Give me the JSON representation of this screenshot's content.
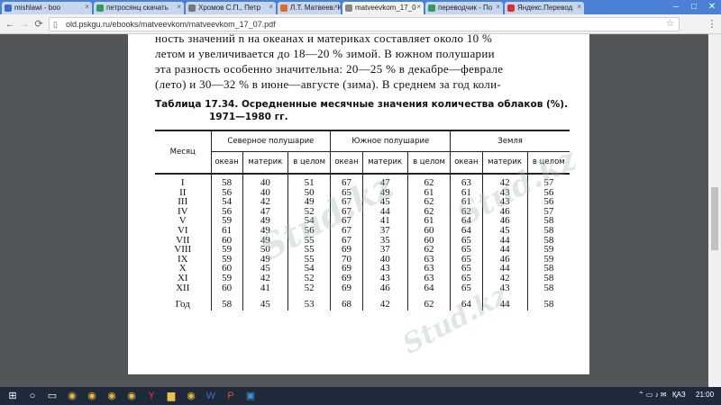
{
  "browser": {
    "tabs": [
      {
        "label": "mishlawi - boo",
        "icon_color": "#3a6fc9",
        "active": false
      },
      {
        "label": "петросянц скачать",
        "icon_color": "#2f9e5a",
        "active": false
      },
      {
        "label": "Хромов С.П., Петр",
        "icon_color": "#777777",
        "active": false
      },
      {
        "label": "Л.Т. Матвеев. Кур",
        "icon_color": "#e56a1f",
        "active": false
      },
      {
        "label": "matveevkom_17_0",
        "icon_color": "#888888",
        "active": true
      },
      {
        "label": "переводчик - По",
        "icon_color": "#2f9e5a",
        "active": false
      },
      {
        "label": "Яндекс.Перевод",
        "icon_color": "#d9302c",
        "active": false
      }
    ],
    "close_glyph": "×",
    "window_controls": {
      "minimize": "–",
      "maximize": "□",
      "close": "✕"
    },
    "nav": {
      "back": "←",
      "forward": "→",
      "reload": "⟳"
    },
    "address": {
      "icon": "page-icon",
      "url": "old.pskgu.ru/ebooks/matveevkom/matveevkom_17_07.pdf"
    },
    "bookmark_glyph": "☆",
    "menu_glyph": "⋮"
  },
  "document": {
    "paragraph_lines": [
      "ность значений n на океанах и материках составляет около 10 %",
      "летом и увеличивается до 18—20 % зимой. В южном полушарии",
      "эта разность особенно значительна: 20—25 % в декабре—феврале",
      "(лето) и 30—32 % в июне—августе (зима). В среднем за год коли-"
    ],
    "caption_line1": "Таблица 17.34.  Осредненные месячные значения количества облаков (%).",
    "caption_line2": "1971—1980 гг.",
    "table": {
      "month_header": "Месяц",
      "groups": [
        "Северное полушарие",
        "Южное полушарие",
        "Земля"
      ],
      "subheaders": [
        "океан",
        "материк",
        "в целом",
        "океан",
        "материк",
        "в целом",
        "океан",
        "материк",
        "в целом"
      ],
      "rows": [
        {
          "month": "I",
          "values": [
            "58",
            "40",
            "51",
            "67",
            "47",
            "62",
            "63",
            "42",
            "57"
          ]
        },
        {
          "month": "II",
          "values": [
            "56",
            "40",
            "50",
            "65",
            "49",
            "61",
            "61",
            "43",
            "56"
          ]
        },
        {
          "month": "III",
          "values": [
            "54",
            "42",
            "49",
            "67",
            "45",
            "62",
            "61",
            "43",
            "56"
          ]
        },
        {
          "month": "IV",
          "values": [
            "56",
            "47",
            "52",
            "67",
            "44",
            "62",
            "62",
            "46",
            "57"
          ]
        },
        {
          "month": "V",
          "values": [
            "59",
            "49",
            "54",
            "67",
            "41",
            "61",
            "64",
            "46",
            "58"
          ]
        },
        {
          "month": "VI",
          "values": [
            "61",
            "49",
            "56",
            "67",
            "37",
            "60",
            "64",
            "45",
            "58"
          ]
        },
        {
          "month": "VII",
          "values": [
            "60",
            "49",
            "55",
            "67",
            "35",
            "60",
            "65",
            "44",
            "58"
          ]
        },
        {
          "month": "VIII",
          "values": [
            "59",
            "50",
            "55",
            "69",
            "37",
            "62",
            "65",
            "44",
            "59"
          ]
        },
        {
          "month": "IX",
          "values": [
            "59",
            "49",
            "55",
            "70",
            "40",
            "63",
            "65",
            "46",
            "59"
          ]
        },
        {
          "month": "X",
          "values": [
            "60",
            "45",
            "54",
            "69",
            "43",
            "63",
            "65",
            "44",
            "58"
          ]
        },
        {
          "month": "XI",
          "values": [
            "59",
            "42",
            "52",
            "69",
            "43",
            "63",
            "65",
            "42",
            "58"
          ]
        },
        {
          "month": "XII",
          "values": [
            "60",
            "41",
            "52",
            "69",
            "46",
            "64",
            "65",
            "43",
            "58"
          ]
        }
      ],
      "year_row": {
        "month": "Год",
        "values": [
          "58",
          "45",
          "53",
          "68",
          "42",
          "62",
          "64",
          "44",
          "58"
        ]
      }
    },
    "watermark": "Stud.kz"
  },
  "taskbar": {
    "start_icon": "windows-icon",
    "apps": [
      "search-icon",
      "task-view-icon",
      "chrome-icon",
      "chrome-icon",
      "chrome-icon",
      "chrome-icon",
      "yandex-icon",
      "folder-icon",
      "chrome-icon",
      "word-icon",
      "powerpoint-icon",
      "store-icon"
    ],
    "language": "ҚАЗ",
    "time": "21:00"
  }
}
